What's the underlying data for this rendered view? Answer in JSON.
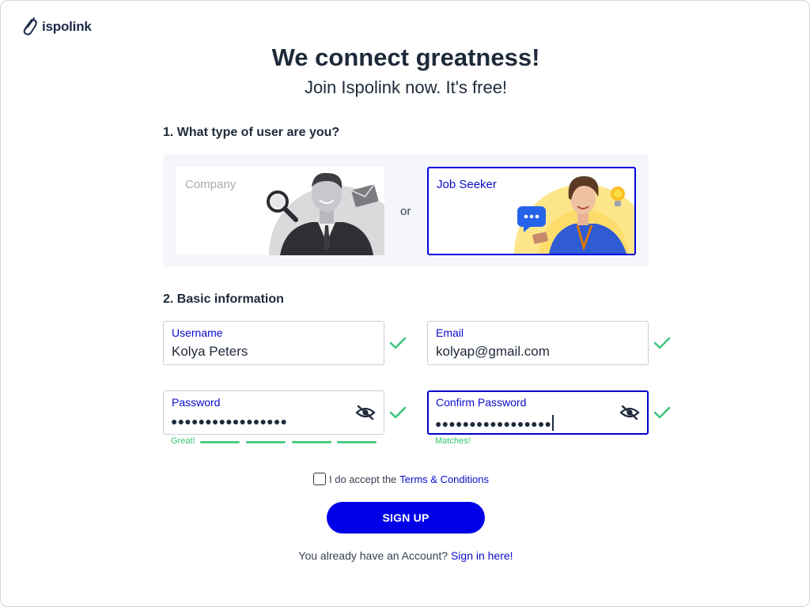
{
  "brand": {
    "name": "ispolink"
  },
  "hero": {
    "title": "We connect greatness!",
    "subtitle": "Join Ispolink now. It's free!"
  },
  "user_type": {
    "heading": "1. What type of user are you?",
    "options": [
      {
        "label": "Company",
        "selected": false
      },
      {
        "label": "Job Seeker",
        "selected": true
      }
    ],
    "or_text": "or"
  },
  "basic_info": {
    "heading": "2. Basic information",
    "username": {
      "label": "Username",
      "value": "Kolya Peters",
      "valid": true
    },
    "email": {
      "label": "Email",
      "value": "kolyap@gmail.com",
      "valid": true
    },
    "password": {
      "label": "Password",
      "masked": "●●●●●●●●●●●●●●●●●",
      "hint": "Great!",
      "strength_segments": 4,
      "valid": true
    },
    "confirm_password": {
      "label": "Confirm Password",
      "masked": "●●●●●●●●●●●●●●●●●",
      "hint": "Matches!",
      "valid": true,
      "focused": true
    }
  },
  "terms": {
    "prefix": "I do accept the",
    "link": "Terms & Conditions",
    "checked": false
  },
  "signup_button": "SIGN UP",
  "signin": {
    "prefix": "You already have an Account?",
    "link": "Sign in here!"
  },
  "colors": {
    "accent": "#0000e8",
    "link": "#0a0acc",
    "success": "#34c46a",
    "heading": "#1e2a3a",
    "panel": "#f4f6fb"
  },
  "icons": {
    "logo": "paperclip-logo-icon",
    "eye": "eye-slash-icon",
    "check": "check-icon"
  }
}
